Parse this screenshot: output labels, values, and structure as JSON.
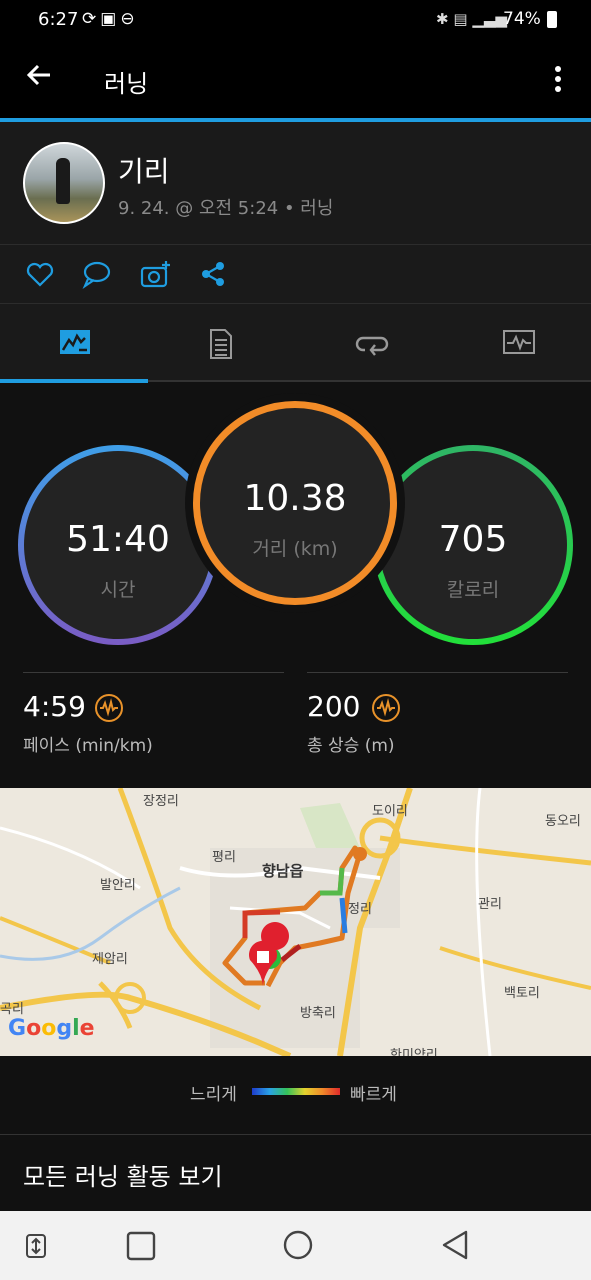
{
  "status_bar": {
    "time": "6:27",
    "battery": "74%",
    "left_icons": [
      "sync-icon",
      "image-icon",
      "do-not-disturb-icon"
    ],
    "right_icons": [
      "bluetooth-icon",
      "lte-icon",
      "signal-icon",
      "battery-icon"
    ]
  },
  "app_bar": {
    "title": "러닝"
  },
  "activity": {
    "user_name": "기리",
    "meta": "9. 24. @ 오전 5:24 • 러닝"
  },
  "social_actions": [
    "like-icon",
    "comment-icon",
    "add-photo-icon",
    "share-icon"
  ],
  "tabs": [
    "summary-tab",
    "details-tab",
    "laps-tab",
    "charts-tab"
  ],
  "stats": {
    "time": {
      "value": "51:40",
      "label": "시간"
    },
    "distance": {
      "value": "10.38",
      "label": "거리 (km)"
    },
    "calories": {
      "value": "705",
      "label": "칼로리"
    },
    "pace": {
      "value": "4:59",
      "label": "페이스 (min/km)"
    },
    "elevation": {
      "value": "200",
      "label": "총 상승 (m)"
    }
  },
  "map": {
    "labels": [
      "장정리",
      "도이리",
      "동오리",
      "평리",
      "향남읍",
      "발안리",
      "정리",
      "관리",
      "제암리",
      "백토리",
      "방축리",
      "곡리",
      "한미약리"
    ],
    "provider": "Google"
  },
  "legend": {
    "slow": "느리게",
    "fast": "빠르게"
  },
  "footer": {
    "all_runs": "모든 러닝 활동 보기"
  },
  "colors": {
    "accent": "#1f9de0",
    "time_ring": "#4a9ee6",
    "distance_ring": "#f28c28",
    "calories_ring": "#2cd45a",
    "pace_icon": "#e8922a"
  }
}
